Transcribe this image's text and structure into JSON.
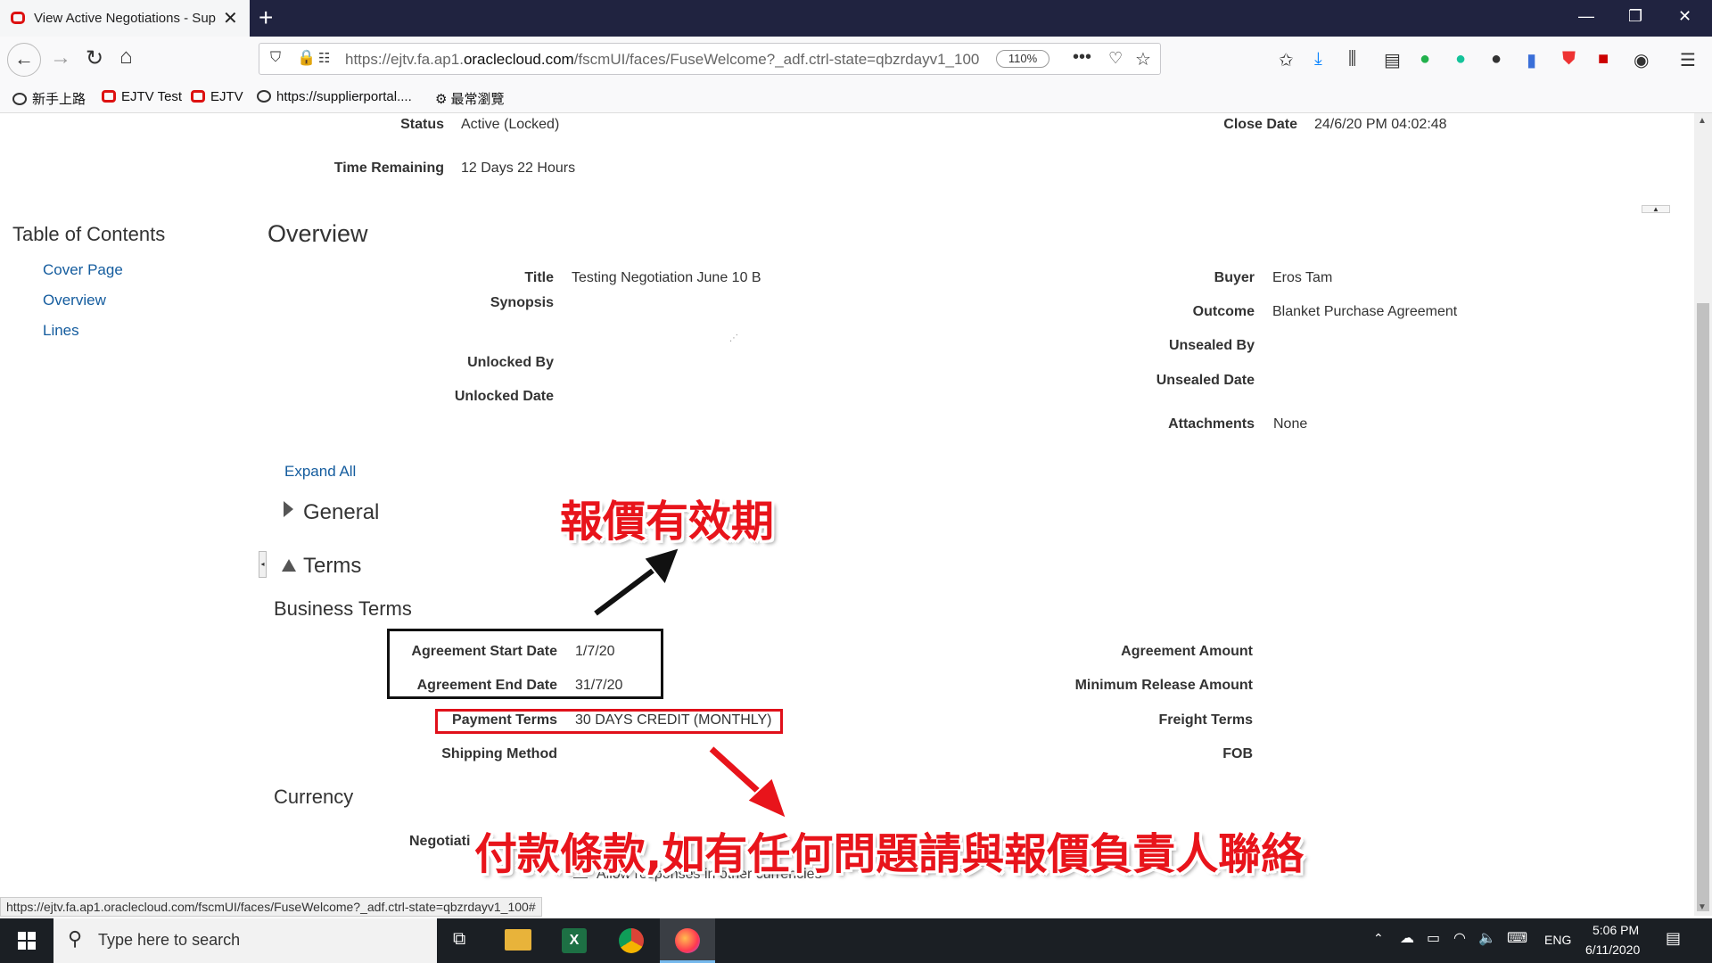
{
  "browser": {
    "tab_title": "View Active Negotiations - Sup",
    "url_prefix": "https://ejtv.fa.ap1.",
    "url_domain": "oraclecloud.com",
    "url_suffix": "/fscmUI/faces/FuseWelcome?_adf.ctrl-state=qbzrdayv1_100",
    "zoom": "110%",
    "status_url": "https://ejtv.fa.ap1.oraclecloud.com/fscmUI/faces/FuseWelcome?_adf.ctrl-state=qbzrdayv1_100#"
  },
  "bookmarks": [
    {
      "label": "新手上路"
    },
    {
      "label": "EJTV Test"
    },
    {
      "label": "EJTV"
    },
    {
      "label": "https://supplierportal...."
    },
    {
      "label": "最常瀏覽"
    }
  ],
  "header_fields": {
    "status_label": "Status",
    "status_value": "Active (Locked)",
    "time_label": "Time Remaining",
    "time_value": "12 Days 22 Hours",
    "close_label": "Close Date",
    "close_value": "24/6/20 PM 04:02:48"
  },
  "toc": {
    "title": "Table of Contents",
    "items": [
      "Cover Page",
      "Overview",
      "Lines"
    ]
  },
  "overview": {
    "heading": "Overview",
    "title_label": "Title",
    "title_value": "Testing Negotiation June 10 B",
    "synopsis_label": "Synopsis",
    "unlocked_by_label": "Unlocked By",
    "unlocked_date_label": "Unlocked Date",
    "buyer_label": "Buyer",
    "buyer_value": "Eros Tam",
    "outcome_label": "Outcome",
    "outcome_value": "Blanket Purchase Agreement",
    "unsealed_by_label": "Unsealed By",
    "unsealed_date_label": "Unsealed Date",
    "attachments_label": "Attachments",
    "attachments_value": "None"
  },
  "sections": {
    "expand_all": "Expand All",
    "general": "General",
    "terms": "Terms",
    "business_terms": "Business Terms",
    "currency": "Currency"
  },
  "terms": {
    "start_label": "Agreement Start Date",
    "start_value": "1/7/20",
    "end_label": "Agreement End Date",
    "end_value": "31/7/20",
    "payment_label": "Payment Terms",
    "payment_value": "30 DAYS CREDIT (MONTHLY)",
    "shipping_label": "Shipping Method",
    "amount_label": "Agreement Amount",
    "min_release_label": "Minimum Release Amount",
    "freight_label": "Freight Terms",
    "fob_label": "FOB"
  },
  "currency": {
    "negotiation_label": "Negotiati",
    "allow_other": "Allow responses in other currencies"
  },
  "annotations": {
    "validity": "報價有效期",
    "payment_note": "付款條款,如有任何問題請與報價負責人聯絡"
  },
  "taskbar": {
    "search_placeholder": "Type here to search",
    "lang": "ENG",
    "time": "5:06 PM",
    "date": "6/11/2020"
  },
  "colors": {
    "accent_link": "#145c9e",
    "annotation_red": "#e8141b",
    "titlebar": "#202340"
  }
}
